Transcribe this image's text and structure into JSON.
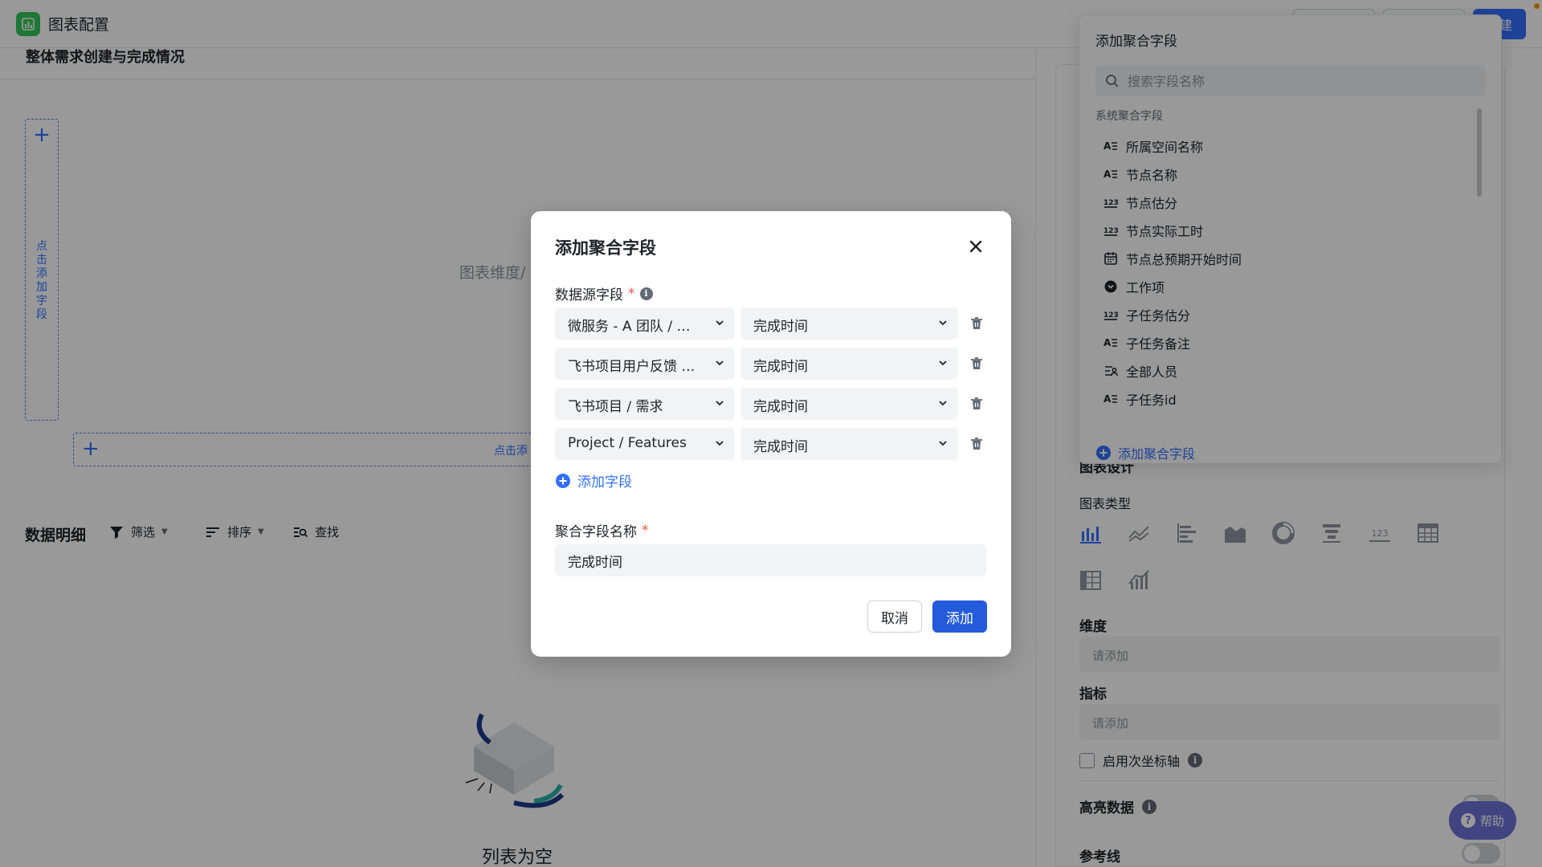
{
  "app": {
    "title": "图表配置",
    "create_button": "新建"
  },
  "left": {
    "chart_title": "整体需求创建与完成情况",
    "vertical_dropzone": "点击添加字段",
    "horizontal_dropzone": "点击添",
    "chart_placeholder": "图表维度/",
    "detail_title": "数据明细",
    "tools": {
      "filter": "筛选",
      "sort": "排序",
      "find": "查找"
    },
    "empty_text": "列表为空"
  },
  "popover": {
    "title": "添加聚合字段",
    "search_placeholder": "搜索字段名称",
    "section": "系统聚合字段",
    "items": [
      {
        "label": "所属空间名称",
        "icon": "text-field-icon"
      },
      {
        "label": "节点名称",
        "icon": "text-field-icon"
      },
      {
        "label": "节点估分",
        "icon": "number-field-icon"
      },
      {
        "label": "节点实际工时",
        "icon": "number-field-icon"
      },
      {
        "label": "节点总预期开始时间",
        "icon": "date-field-icon"
      },
      {
        "label": "工作项",
        "icon": "work-item-icon"
      },
      {
        "label": "子任务估分",
        "icon": "number-field-icon"
      },
      {
        "label": "子任务备注",
        "icon": "text-field-icon"
      },
      {
        "label": "全部人员",
        "icon": "people-field-icon"
      },
      {
        "label": "子任务id",
        "icon": "text-field-icon"
      }
    ],
    "footer": "添加聚合字段"
  },
  "config": {
    "section_design": "图表设计",
    "chart_type_label": "图表类型",
    "dimension_label": "维度",
    "dimension_placeholder": "请添加",
    "metric_label": "指标",
    "metric_placeholder": "请添加",
    "secondary_axis": "启用次坐标轴",
    "highlight_label": "高亮数据",
    "reference_label": "参考线"
  },
  "modal": {
    "title": "添加聚合字段",
    "source_label": "数据源字段",
    "rows": [
      {
        "source": "微服务 - A 团队 / 需...",
        "field": "完成时间"
      },
      {
        "source": "飞书项目用户反馈 / ...",
        "field": "完成时间"
      },
      {
        "source": "飞书项目 / 需求",
        "field": "完成时间"
      },
      {
        "source": "Project / Features",
        "field": "完成时间"
      }
    ],
    "add_field": "添加字段",
    "name_label": "聚合字段名称",
    "name_value": "完成时间",
    "cancel": "取消",
    "confirm": "添加"
  },
  "help": {
    "label": "帮助"
  },
  "colors": {
    "accent": "#3370ff",
    "primary_button": "#245bdb",
    "required": "#f54a45",
    "logo": "#34c759"
  }
}
